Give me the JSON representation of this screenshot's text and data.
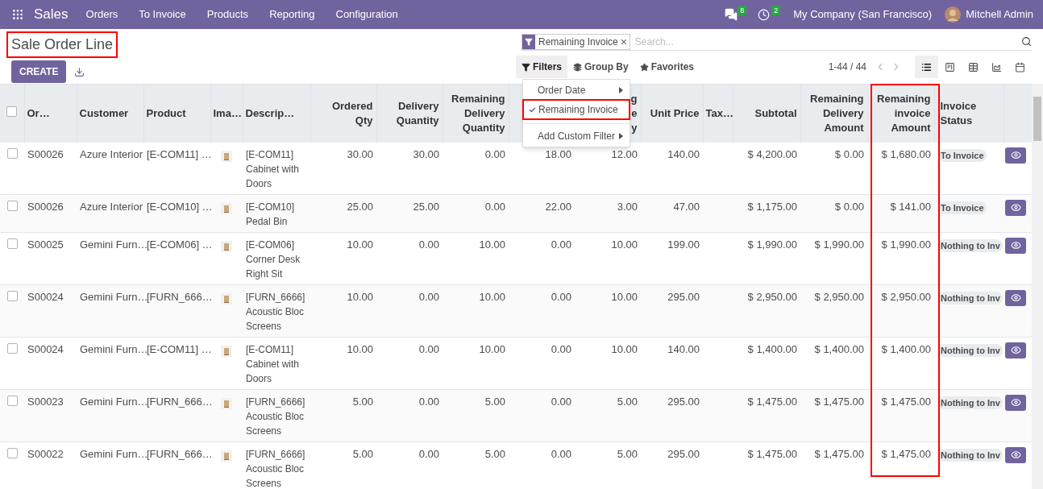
{
  "navbar": {
    "app": "Sales",
    "menu": [
      "Orders",
      "To Invoice",
      "Products",
      "Reporting",
      "Configuration"
    ],
    "messages_badge": "8",
    "activities_badge": "2",
    "company": "My Company (San Francisco)",
    "user": "Mitchell Admin"
  },
  "title": "Sale Order Line",
  "create_button": "CREATE",
  "search": {
    "facets": [
      "Remaining Invoice"
    ],
    "placeholder": "Search..."
  },
  "search_buttons": [
    {
      "label": "Filters",
      "selected": true
    },
    {
      "label": "Group By",
      "selected": false
    },
    {
      "label": "Favorites",
      "selected": false
    }
  ],
  "pager": "1-44 / 44",
  "views": [
    {
      "selected": true
    },
    {
      "selected": false
    },
    {
      "selected": false
    },
    {
      "selected": false
    },
    {
      "selected": false
    }
  ],
  "filters_menu": [
    {
      "kind": "submenu",
      "label": "Order Date",
      "checked": false
    },
    {
      "kind": "option",
      "label": "Remaining Invoice",
      "checked": true
    },
    {
      "kind": "divider"
    },
    {
      "kind": "submenu",
      "label": "Add Custom Filter",
      "checked": false
    }
  ],
  "table": {
    "header_checked": false,
    "columns": [
      {
        "label": "Or…",
        "kind": "text"
      },
      {
        "label": "Customer",
        "kind": "text"
      },
      {
        "label": "Product",
        "kind": "text"
      },
      {
        "label": "Ima…"
      },
      {
        "label": "Descrip…",
        "kind": "text"
      },
      {
        "label": "Ordered Qty",
        "kind": "number"
      },
      {
        "label": "Delivery Quantity",
        "kind": "number"
      },
      {
        "label": "Remaining Delivery Quantity",
        "kind": "number"
      },
      {
        "kind": "number"
      },
      {
        "lines": [
          "g",
          "e",
          "y"
        ],
        "kind": "number"
      },
      {
        "label": "Unit Price",
        "kind": "number"
      },
      {
        "label": "Tax…",
        "kind": "text"
      },
      {
        "label": "Subtotal",
        "kind": "number"
      },
      {
        "label": "Remaining Delivery Amount",
        "kind": "number"
      },
      {
        "label": "Remaining invoice Amount",
        "kind": "number"
      },
      {
        "label": "Invoice Status",
        "kind": "badge"
      }
    ],
    "rows": [
      {
        "selected": false,
        "cells": [
          "S00026",
          "Azure Interior",
          "[E-COM11] …",
          null,
          [
            "[E-COM11]",
            "Cabinet with",
            "Doors"
          ],
          "30.00",
          "30.00",
          "0.00",
          "18.00",
          "12.00",
          "140.00",
          null,
          "$ 4,200.00",
          "$ 0.00",
          "$ 1,680.00",
          "To Invoice"
        ]
      },
      {
        "selected": false,
        "cells": [
          "S00026",
          "Azure Interior",
          "[E-COM10] …",
          null,
          [
            "[E-COM10]",
            "Pedal Bin"
          ],
          "25.00",
          "25.00",
          "0.00",
          "22.00",
          "3.00",
          "47.00",
          null,
          "$ 1,175.00",
          "$ 0.00",
          "$ 141.00",
          "To Invoice"
        ]
      },
      {
        "selected": false,
        "cells": [
          "S00025",
          "Gemini Furn…",
          "[E-COM06] …",
          null,
          [
            "[E-COM06]",
            "Corner Desk",
            "Right Sit"
          ],
          "10.00",
          "0.00",
          "10.00",
          "0.00",
          "10.00",
          "199.00",
          null,
          "$ 1,990.00",
          "$ 1,990.00",
          "$ 1,990.00",
          "Nothing to Inv"
        ]
      },
      {
        "selected": false,
        "cells": [
          "S00024",
          "Gemini Furn…",
          "[FURN_666…",
          null,
          [
            "[FURN_6666]",
            "Acoustic Bloc",
            "Screens"
          ],
          "10.00",
          "0.00",
          "10.00",
          "0.00",
          "10.00",
          "295.00",
          null,
          "$ 2,950.00",
          "$ 2,950.00",
          "$ 2,950.00",
          "Nothing to Inv"
        ]
      },
      {
        "selected": false,
        "cells": [
          "S00024",
          "Gemini Furn…",
          "[E-COM11] …",
          null,
          [
            "[E-COM11]",
            "Cabinet with",
            "Doors"
          ],
          "10.00",
          "0.00",
          "10.00",
          "0.00",
          "10.00",
          "140.00",
          null,
          "$ 1,400.00",
          "$ 1,400.00",
          "$ 1,400.00",
          "Nothing to Inv"
        ]
      },
      {
        "selected": false,
        "cells": [
          "S00023",
          "Gemini Furn…",
          "[FURN_666…",
          null,
          [
            "[FURN_6666]",
            "Acoustic Bloc",
            "Screens"
          ],
          "5.00",
          "0.00",
          "5.00",
          "0.00",
          "5.00",
          "295.00",
          null,
          "$ 1,475.00",
          "$ 1,475.00",
          "$ 1,475.00",
          "Nothing to Inv"
        ]
      },
      {
        "selected": false,
        "cells": [
          "S00022",
          "Gemini Furn…",
          "[FURN_666…",
          null,
          [
            "[FURN_6666]",
            "Acoustic Bloc",
            "Screens"
          ],
          "5.00",
          "0.00",
          "5.00",
          "0.00",
          "5.00",
          "295.00",
          null,
          "$ 1,475.00",
          "$ 1,475.00",
          "$ 1,475.00",
          "Nothing to Inv"
        ]
      }
    ]
  }
}
